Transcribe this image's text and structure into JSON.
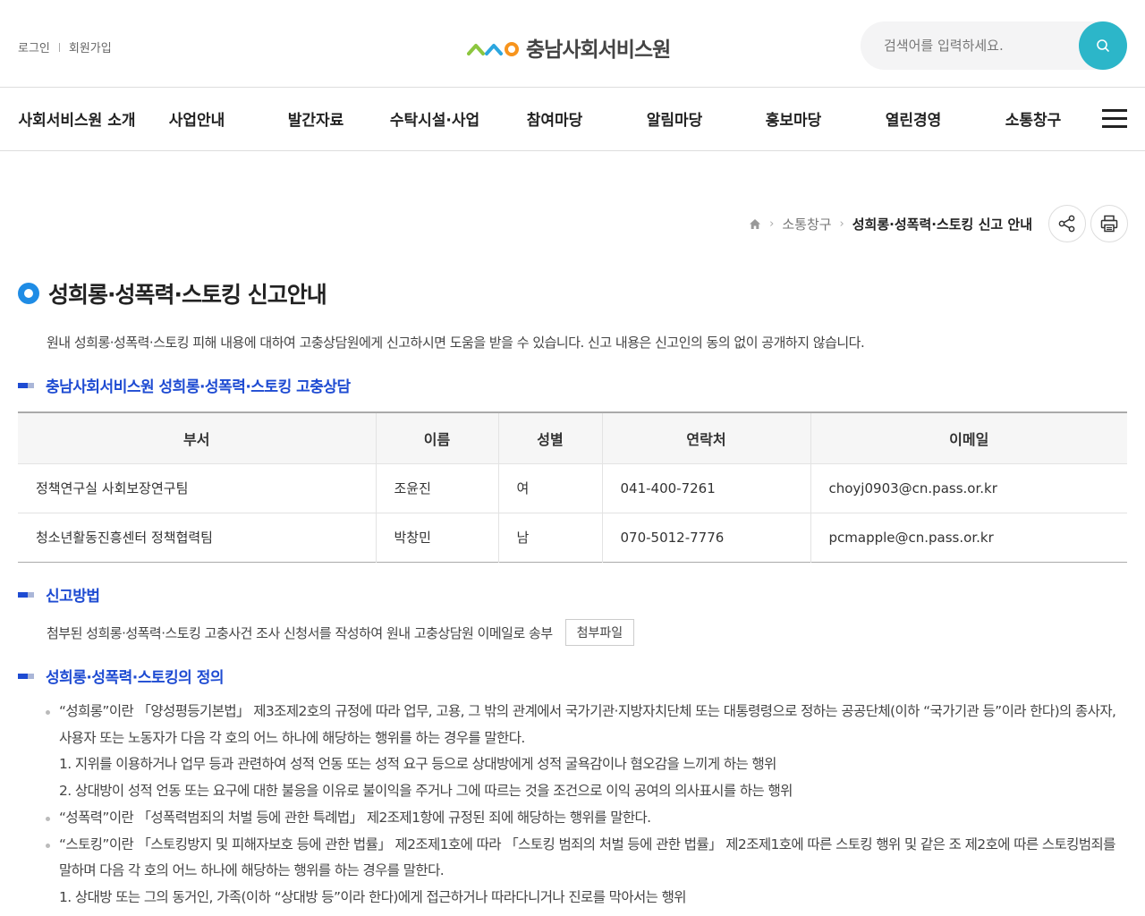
{
  "header": {
    "login": "로그인",
    "join": "회원가입",
    "logo_text": "충남사회서비스원",
    "search_placeholder": "검색어를 입력하세요."
  },
  "nav": {
    "items": [
      "사회서비스원 소개",
      "사업안내",
      "발간자료",
      "수탁시설·사업",
      "참여마당",
      "알림마당",
      "홍보마당",
      "열린경영",
      "소통창구"
    ]
  },
  "breadcrumb": {
    "level1": "소통창구",
    "current": "성희롱·성폭력·스토킹 신고 안내"
  },
  "page": {
    "title": "성희롱·성폭력·스토킹 신고안내",
    "intro": "원내 성희롱·성폭력·스토킹 피해 내용에 대하여 고충상담원에게 신고하시면 도움을 받을 수 있습니다. 신고 내용은 신고인의 동의 없이 공개하지 않습니다."
  },
  "counsel": {
    "title": "충남사회서비스원 성희롱·성폭력·스토킹 고충상담",
    "headers": [
      "부서",
      "이름",
      "성별",
      "연락처",
      "이메일"
    ],
    "rows": [
      [
        "정책연구실 사회보장연구팀",
        "조윤진",
        "여",
        "041-400-7261",
        "choyj0903@cn.pass.or.kr"
      ],
      [
        "청소년활동진흥센터 정책협력팀",
        "박창민",
        "남",
        "070-5012-7776",
        "pcmapple@cn.pass.or.kr"
      ]
    ]
  },
  "method": {
    "title": "신고방법",
    "text": "첨부된 성희롱·성폭력·스토킹 고충사건 조사 신청서를 작성하여 원내 고충상담원 이메일로 송부",
    "file_button": "첨부파일"
  },
  "definition": {
    "title": "성희롱·성폭력·스토킹의 정의",
    "harassment": "“성희롱”이란 「양성평등기본법」 제3조제2호의 규정에 따라 업무, 고용, 그 밖의 관계에서 국가기관·지방자치단체 또는 대통령령으로 정하는 공공단체(이하 “국가기관 등”이라 한다)의 종사자, 사용자 또는 노동자가 다음 각 호의 어느 하나에 해당하는 행위를 하는 경우를 말한다.",
    "harassment_1": "1. 지위를 이용하거나 업무 등과 관련하여 성적 언동 또는 성적 요구 등으로 상대방에게 성적 굴욕감이나 혐오감을 느끼게 하는 행위",
    "harassment_2": "2. 상대방이 성적 언동 또는 요구에 대한 불응을 이유로 불이익을 주거나 그에 따르는 것을 조건으로 이익 공여의 의사표시를 하는 행위",
    "violence": "“성폭력”이란 「성폭력범죄의 처벌 등에 관한 특례법」 제2조제1항에 규정된 죄에 해당하는 행위를 말한다.",
    "stalking": "“스토킹”이란 「스토킹방지 및 피해자보호 등에 관한 법률」 제2조제1호에 따라 「스토킹 범죄의 처벌 등에 관한 법률」 제2조제1호에 따른 스토킹 행위 및 같은 조 제2호에 따른 스토킹범죄를 말하며 다음 각 호의 어느 하나에 해당하는 행위를 하는 경우를 말한다.",
    "stalking_1": "1. 상대방 또는 그의 동거인, 가족(이하 “상대방 등”이라 한다)에게 접근하거나 따라다니거나 진로를 막아서는 행위"
  }
}
